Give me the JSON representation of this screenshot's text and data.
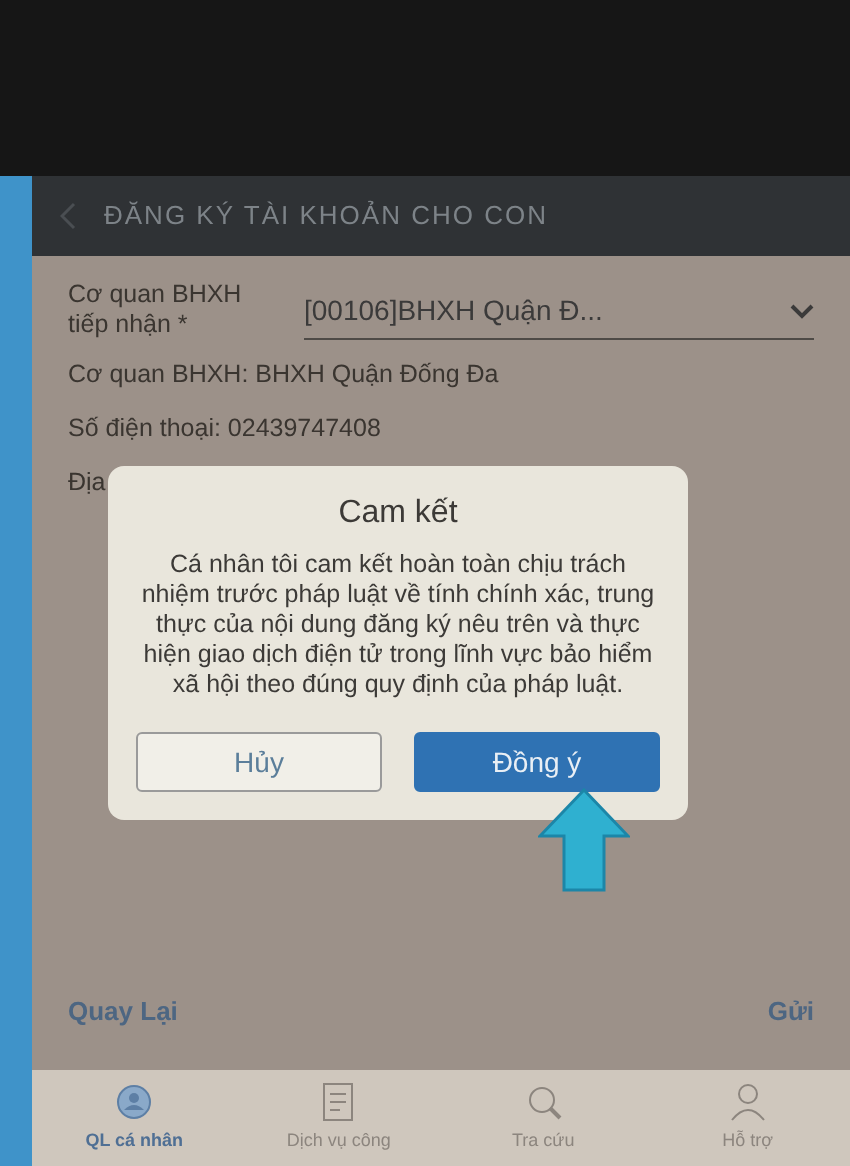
{
  "header": {
    "title": "ĐĂNG KÝ TÀI KHOẢN CHO CON"
  },
  "form": {
    "agency_label": "Cơ quan BHXH tiếp nhận *",
    "agency_value": "[00106]BHXH Quận Đ...",
    "lines": [
      "Cơ quan BHXH: BHXH Quận Đống Đa",
      "Số điện thoại: 02439747408",
      "Địa"
    ]
  },
  "dialog": {
    "title": "Cam kết",
    "message": "Cá nhân tôi cam kết hoàn toàn chịu trách nhiệm trước pháp luật về tính chính xác, trung thực của nội dung đăng ký nêu trên và thực hiện giao dịch điện tử trong lĩnh vực bảo hiểm xã hội theo đúng quy định của pháp luật.",
    "buttons": [
      {
        "label": "Hủy",
        "kind": "outline"
      },
      {
        "label": "Đồng ý",
        "kind": "primary"
      }
    ]
  },
  "actions": {
    "back": "Quay Lại",
    "send": "Gửi"
  },
  "tabs": [
    {
      "label": "QL cá nhân",
      "selected": true
    },
    {
      "label": "Dịch vụ công",
      "selected": false
    },
    {
      "label": "Tra cứu",
      "selected": false
    },
    {
      "label": "Hỗ trợ",
      "selected": false
    }
  ]
}
